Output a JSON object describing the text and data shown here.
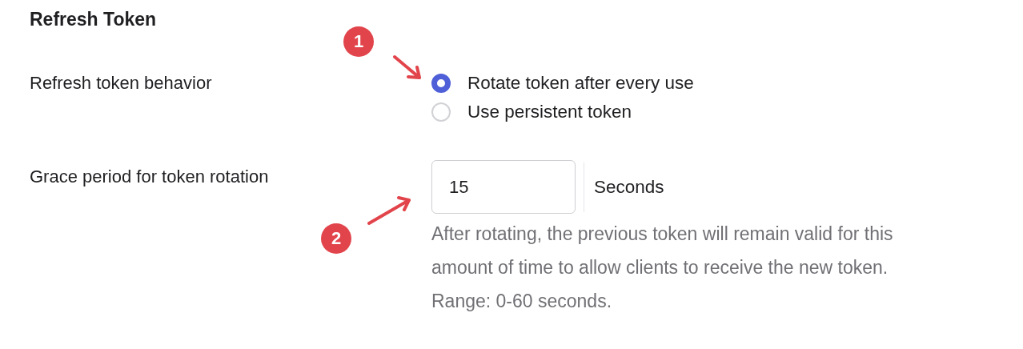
{
  "section_title": "Refresh Token",
  "fields": [
    {
      "kind": "radio",
      "label": "Refresh token behavior",
      "options": [
        {
          "label": "Rotate token after every use",
          "selected": true
        },
        {
          "label": "Use persistent token",
          "selected": false
        }
      ]
    },
    {
      "kind": "number",
      "label": "Grace period for token rotation",
      "value": "15",
      "unit": "Seconds",
      "help": "After rotating, the previous token will remain valid for this amount of time to allow clients to receive the new token.",
      "help_note": "Range: 0-60 seconds."
    }
  ],
  "annotations": [
    {
      "number": "1"
    },
    {
      "number": "2"
    }
  ]
}
